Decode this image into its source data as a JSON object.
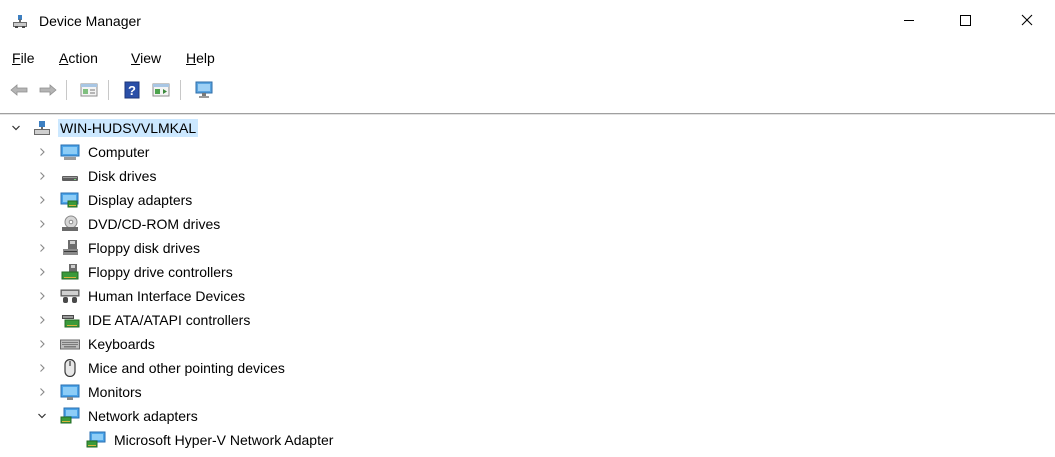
{
  "window": {
    "title": "Device Manager"
  },
  "menu": {
    "file": {
      "accel": "F",
      "rest": "ile"
    },
    "action": {
      "accel": "A",
      "rest": "ction"
    },
    "view": {
      "accel": "V",
      "rest": "iew"
    },
    "help": {
      "accel": "H",
      "rest": "elp"
    }
  },
  "toolbar": {
    "buttons": [
      "back-arrow-icon",
      "forward-arrow-icon",
      "properties-icon",
      "help-icon",
      "update-driver-icon",
      "scan-hardware-icon"
    ]
  },
  "tree": {
    "root": {
      "label": "WIN-HUDSVVLMKAL",
      "expanded": true
    },
    "categories": [
      {
        "label": "Computer",
        "icon": "computer-icon",
        "expanded": false
      },
      {
        "label": "Disk drives",
        "icon": "disk-drive-icon",
        "expanded": false
      },
      {
        "label": "Display adapters",
        "icon": "display-adapter-icon",
        "expanded": false
      },
      {
        "label": "DVD/CD-ROM drives",
        "icon": "dvd-drive-icon",
        "expanded": false
      },
      {
        "label": "Floppy disk drives",
        "icon": "floppy-drive-icon",
        "expanded": false
      },
      {
        "label": "Floppy drive controllers",
        "icon": "floppy-controller-icon",
        "expanded": false
      },
      {
        "label": "Human Interface Devices",
        "icon": "hid-icon",
        "expanded": false
      },
      {
        "label": "IDE ATA/ATAPI controllers",
        "icon": "ide-controller-icon",
        "expanded": false
      },
      {
        "label": "Keyboards",
        "icon": "keyboard-icon",
        "expanded": false
      },
      {
        "label": "Mice and other pointing devices",
        "icon": "mouse-icon",
        "expanded": false
      },
      {
        "label": "Monitors",
        "icon": "monitor-icon",
        "expanded": false
      },
      {
        "label": "Network adapters",
        "icon": "network-adapter-icon",
        "expanded": true
      }
    ],
    "children": {
      "network_adapters": [
        {
          "label": "Microsoft Hyper-V Network Adapter",
          "icon": "network-adapter-icon"
        }
      ]
    }
  },
  "colors": {
    "selection": "#cce8ff",
    "chevron": "#6d6d6d"
  }
}
